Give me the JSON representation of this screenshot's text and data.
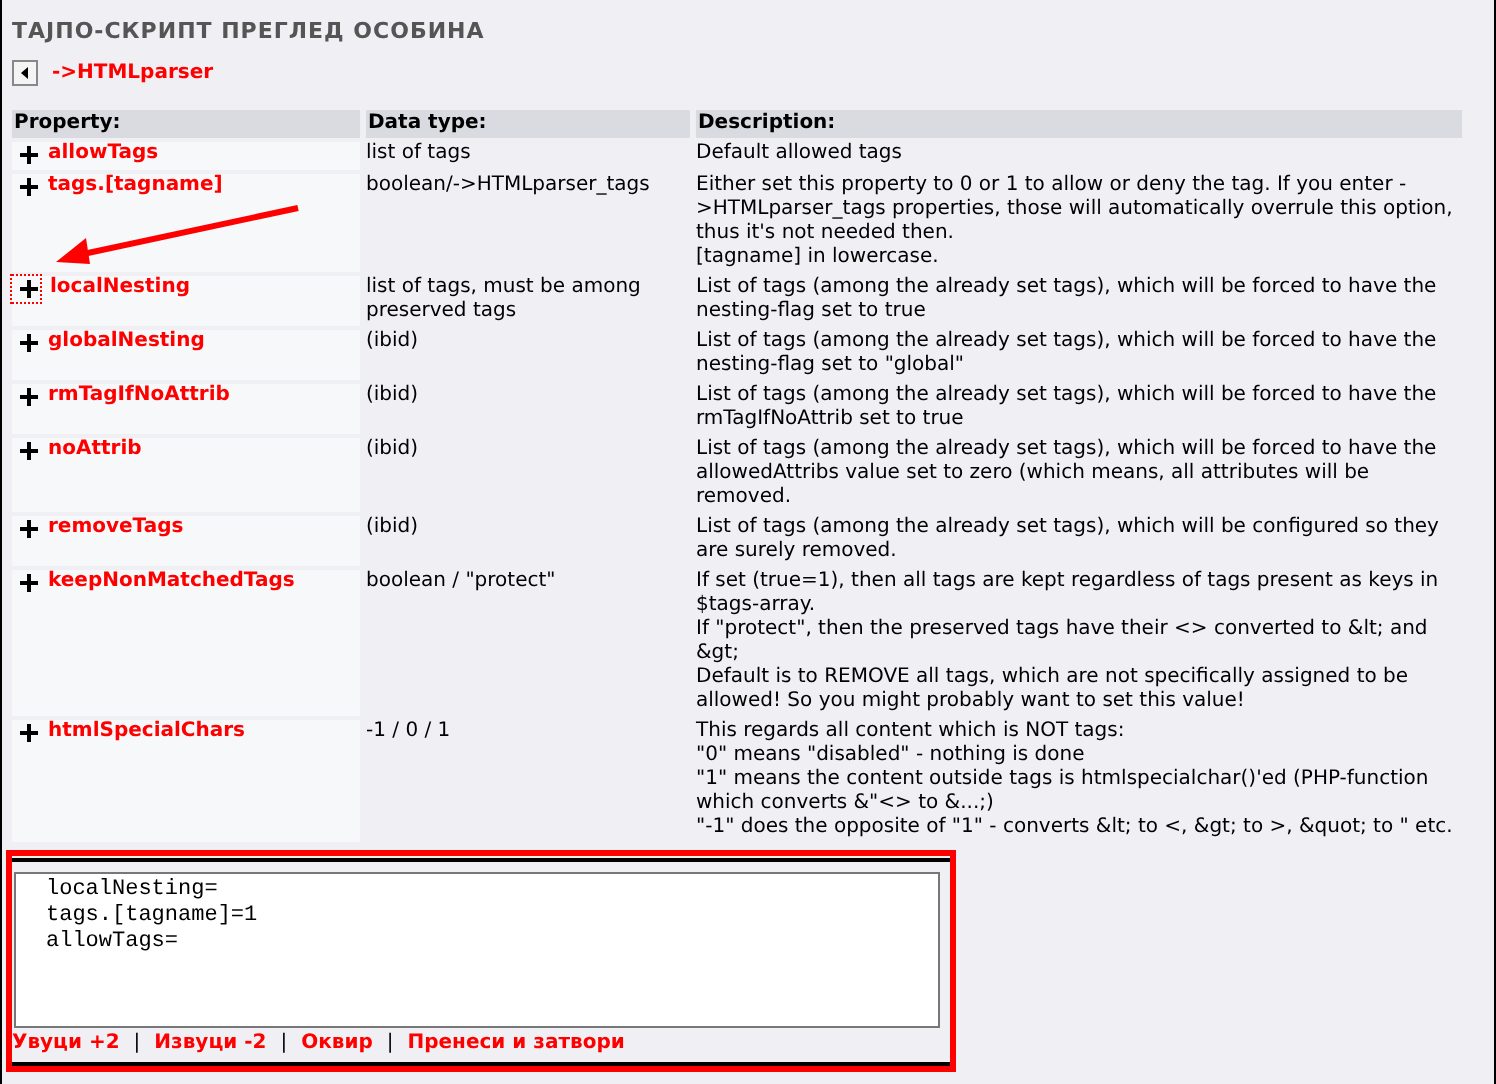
{
  "title": "ТАЈПО-СКРИПТ ПРЕГЛЕД ОСОБИНА",
  "back_link": "->HTMLparser",
  "table": {
    "columns": [
      "Property:",
      "Data type:",
      "Description:"
    ],
    "rows": [
      {
        "property": "allowTags",
        "type": "list of tags",
        "description": [
          "Default allowed tags"
        ],
        "focused": false
      },
      {
        "property": "tags.[tagname]",
        "type": "boolean/->HTMLparser_tags",
        "description": [
          "Either set this property to 0 or 1 to allow or deny the tag. If you enter ->HTMLparser_tags properties, those will automatically overrule this option, thus it's not needed then.",
          "[tagname] in lowercase."
        ],
        "focused": false
      },
      {
        "property": "localNesting",
        "type": "list of tags, must be among preserved tags",
        "description": [
          "List of tags (among the already set tags), which will be forced to have the nesting-flag set to true"
        ],
        "focused": true
      },
      {
        "property": "globalNesting",
        "type": "(ibid)",
        "description": [
          "List of tags (among the already set tags), which will be forced to have the nesting-flag set to \"global\""
        ],
        "focused": false
      },
      {
        "property": "rmTagIfNoAttrib",
        "type": "(ibid)",
        "description": [
          "List of tags (among the already set tags), which will be forced to have the rmTagIfNoAttrib set to true"
        ],
        "focused": false
      },
      {
        "property": "noAttrib",
        "type": "(ibid)",
        "description": [
          "List of tags (among the already set tags), which will be forced to have the allowedAttribs value set to zero (which means, all attributes will be removed."
        ],
        "focused": false
      },
      {
        "property": "removeTags",
        "type": "(ibid)",
        "description": [
          "List of tags (among the already set tags), which will be configured so they are surely removed."
        ],
        "focused": false
      },
      {
        "property": "keepNonMatchedTags",
        "type": "boolean / \"protect\"",
        "description": [
          "If set (true=1), then all tags are kept regardless of tags present as keys in $tags-array.",
          "If \"protect\", then the preserved tags have their <> converted to &lt; and &gt;",
          "Default is to REMOVE all tags, which are not specifically assigned to be allowed! So you might probably want to set this value!"
        ],
        "focused": false
      },
      {
        "property": "htmlSpecialChars",
        "type": "-1 / 0 / 1",
        "description": [
          "This regards all content which is NOT tags:",
          "\"0\" means \"disabled\" - nothing is done",
          "\"1\" means the content outside tags is htmlspecialchar()'ed (PHP-function which converts &\"<> to &...;)",
          "\"-1\" does the opposite of \"1\" - converts &lt; to <, &gt; to >, &quot; to \" etc."
        ],
        "focused": false
      }
    ]
  },
  "editor": {
    "lines": [
      "localNesting=",
      "tags.[tagname]=1",
      "allowTags="
    ]
  },
  "actions": {
    "separator": "|",
    "links": [
      "Увуци +2",
      "Извуци -2",
      "Оквир",
      "Пренеси и затвори"
    ]
  }
}
